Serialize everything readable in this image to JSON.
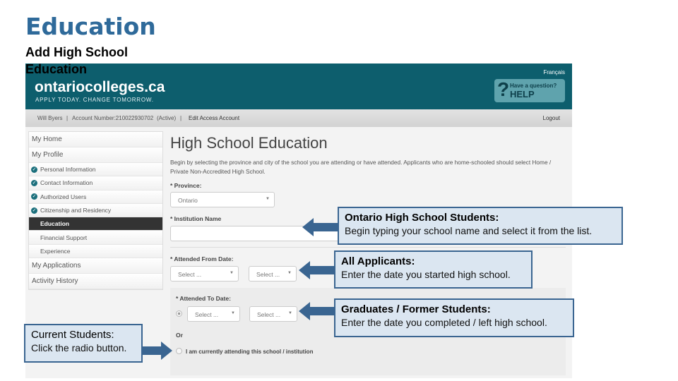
{
  "slide": {
    "title": "Education",
    "subtitle": "Add High School Education"
  },
  "site": {
    "logo": "ontariocolleges.ca",
    "tagline": "APPLY TODAY. CHANGE TOMORROW.",
    "language_link": "Français",
    "help": {
      "line1": "Have a question?",
      "line2": "HELP",
      "icon": "question-mark-icon"
    }
  },
  "account_bar": {
    "name": "Will Byers",
    "account": "Account Number:210022930702",
    "status": "(Active)",
    "edit": "Edit Access Account",
    "logout": "Logout"
  },
  "sidebar": {
    "items": [
      {
        "label": "My Home"
      },
      {
        "label": "My Profile"
      },
      {
        "label": "Personal Information",
        "done": true
      },
      {
        "label": "Contact Information",
        "done": true
      },
      {
        "label": "Authorized Users",
        "done": true
      },
      {
        "label": "Citizenship and Residency",
        "done": true
      },
      {
        "label": "Education",
        "active": true
      },
      {
        "label": "Financial Support"
      },
      {
        "label": "Experience"
      },
      {
        "label": "My Applications"
      },
      {
        "label": "Activity History"
      }
    ]
  },
  "form": {
    "title": "High School Education",
    "intro": "Begin by selecting the province and city of the school you are attending or have attended. Applicants who are home-schooled should select Home / Private Non-Accredited High School.",
    "province_label": "* Province:",
    "province_value": "Ontario",
    "institution_label": "* Institution Name",
    "institution_value": "",
    "from_label": "* Attended From Date:",
    "from_month": "Select ...",
    "from_year": "Select ...",
    "to_label": "* Attended To Date:",
    "to_month": "Select ...",
    "to_year": "Select ...",
    "or": "Or",
    "current_label": "I am currently attending this school / institution"
  },
  "callouts": [
    {
      "heading": "Ontario High School Students:",
      "body": "Begin typing your school name and select it from the list."
    },
    {
      "heading": "All Applicants:",
      "body": "Enter the date you started high school."
    },
    {
      "heading": "Graduates / Former Students:",
      "body": "Enter the date you completed / left high school."
    },
    {
      "heading": "Current Students:",
      "body": "Click the radio button."
    }
  ],
  "colors": {
    "header": "#0d5e6d",
    "callout_bg": "#dbe6f1",
    "callout_border": "#3a6591",
    "arrow": "#3a6591"
  }
}
